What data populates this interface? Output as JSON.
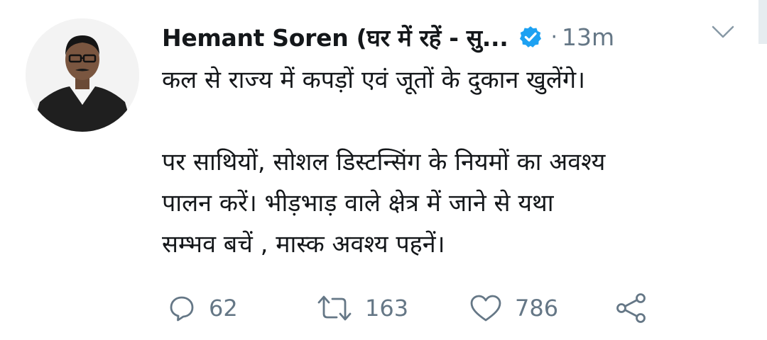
{
  "tweet": {
    "display_name": "Hemant Soren (घर में रहें - सु...",
    "verified_icon": "verified-badge-icon",
    "separator": "·",
    "timestamp": "13m",
    "text_lines": {
      "p1": "कल से राज्य में कपड़ों एवं जूतों के दुकान खुलेंगे।",
      "p2_l1": "पर साथियों, सोशल डिस्टन्सिंग के नियमों का अवश्य",
      "p2_l2": "पालन करें। भीड़भाड़ वाले क्षेत्र में जाने से यथा",
      "p2_l3": "सम्भव बचें , मास्क अवश्य पहनें।"
    }
  },
  "actions": {
    "reply_count": "62",
    "retweet_count": "163",
    "like_count": "786"
  },
  "colors": {
    "text": "#14171a",
    "muted": "#657786",
    "verified": "#1da1f2"
  }
}
